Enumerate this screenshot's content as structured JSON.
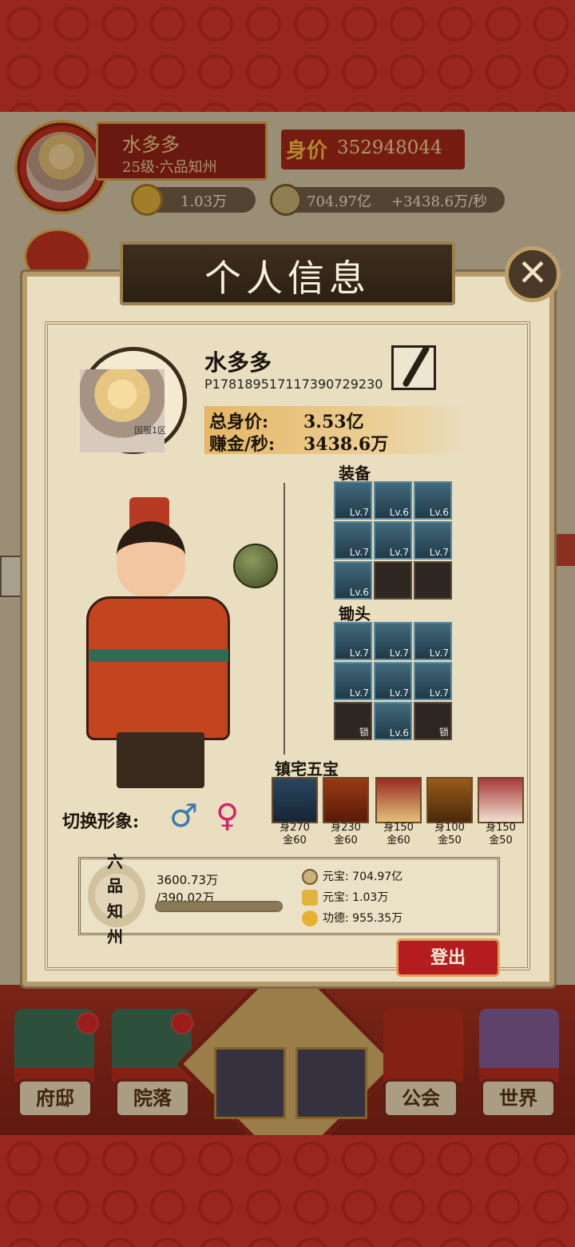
{
  "hud": {
    "player_name": "水多多",
    "level_title": "25级·六品知州",
    "worth_label": "身价",
    "worth_value": "352948044",
    "ingot": "1.03万",
    "coins": "704.97亿",
    "coins_rate": "+3438.6万/秒"
  },
  "dialog": {
    "title": "个人信息",
    "close_symbol": "✕",
    "server": "国服1区",
    "name": "水多多",
    "player_id": "P178189517117390729230",
    "total_worth_label": "总身价:",
    "total_worth_value": "3.53亿",
    "earn_label": "赚金/秒:",
    "earn_value": "3438.6万",
    "switch_label": "切换形象:",
    "male_symbol": "♂",
    "female_symbol": "♀",
    "equipment_title": "装备",
    "equipment": [
      "Lv.7",
      "Lv.6",
      "Lv.6",
      "Lv.7",
      "Lv.7",
      "Lv.7",
      "Lv.6",
      "",
      ""
    ],
    "hoe_title": "锄头",
    "hoe": [
      "Lv.7",
      "Lv.7",
      "Lv.7",
      "Lv.7",
      "Lv.7",
      "Lv.7",
      "锁",
      "Lv.6",
      "锁"
    ],
    "treasures_title": "镇宅五宝",
    "treasures": [
      {
        "a": "身270",
        "b": "金60"
      },
      {
        "a": "身230",
        "b": "金60"
      },
      {
        "a": "身150",
        "b": "金60"
      },
      {
        "a": "身100",
        "b": "金50"
      },
      {
        "a": "身150",
        "b": "金50"
      }
    ],
    "rank_chars": [
      "六",
      "品",
      "知",
      "州"
    ],
    "rank_progress_value": "3600.73万",
    "rank_progress_total": "/390.02万",
    "rank_progress_fraction": 1.0,
    "yuanbao_coin_label": "元宝: 704.97亿",
    "yuanbao_ingot_label": "元宝: 1.03万",
    "merit_label": "功德: 955.35万",
    "logout": "登出"
  },
  "nav": {
    "home": "府邸",
    "courtyard": "院落",
    "guild": "公会",
    "world": "世界"
  },
  "colors": {
    "accent_red": "#b51c20",
    "gold": "#e3b33c",
    "slot_blue": "#436a7c"
  }
}
